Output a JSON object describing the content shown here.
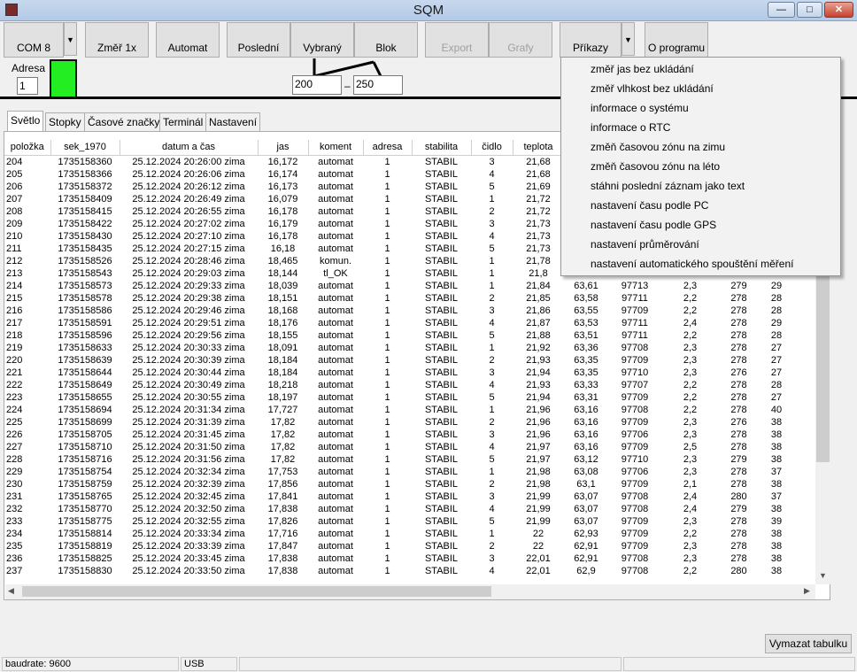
{
  "window": {
    "title": "SQM",
    "minimize": "—",
    "maximize": "□",
    "close": "✕",
    "icon": "sqm-app-icon"
  },
  "toolbar": {
    "com": "COM 8",
    "zmer": "Změř 1x",
    "automat": "Automat",
    "posledni": "Poslední",
    "vybrany": "Vybraný",
    "blok": "Blok",
    "export": "Export",
    "grafy": "Grafy",
    "prikazy": "Příkazy",
    "oprogramu": "O programu",
    "dropdown_arrow": "▼"
  },
  "address": {
    "label": "Adresa",
    "value": "1",
    "indicator_color": "#22ee22"
  },
  "range": {
    "from": "200",
    "dash": "–",
    "to": "250"
  },
  "tabs": [
    "Světlo",
    "Stopky",
    "Časové značky",
    "Terminál",
    "Nastavení"
  ],
  "columns": [
    "položka",
    "sek_1970",
    "datum a čas",
    "jas",
    "koment",
    "adresa",
    "stabilita",
    "čidlo",
    "teplota",
    "",
    "",
    "",
    "",
    ""
  ],
  "rows": [
    [
      "204",
      "1735158360",
      "25.12.2024 20:26:00 zima",
      "16,172",
      "automat",
      "1",
      "STABIL",
      "3",
      "21,68",
      "",
      "",
      "",
      "",
      ""
    ],
    [
      "205",
      "1735158366",
      "25.12.2024 20:26:06 zima",
      "16,174",
      "automat",
      "1",
      "STABIL",
      "4",
      "21,68",
      "",
      "",
      "",
      "",
      ""
    ],
    [
      "206",
      "1735158372",
      "25.12.2024 20:26:12 zima",
      "16,173",
      "automat",
      "1",
      "STABIL",
      "5",
      "21,69",
      "",
      "",
      "",
      "",
      ""
    ],
    [
      "207",
      "1735158409",
      "25.12.2024 20:26:49 zima",
      "16,079",
      "automat",
      "1",
      "STABIL",
      "1",
      "21,72",
      "",
      "",
      "",
      "",
      ""
    ],
    [
      "208",
      "1735158415",
      "25.12.2024 20:26:55 zima",
      "16,178",
      "automat",
      "1",
      "STABIL",
      "2",
      "21,72",
      "",
      "",
      "",
      "",
      ""
    ],
    [
      "209",
      "1735158422",
      "25.12.2024 20:27:02 zima",
      "16,179",
      "automat",
      "1",
      "STABIL",
      "3",
      "21,73",
      "",
      "",
      "",
      "",
      ""
    ],
    [
      "210",
      "1735158430",
      "25.12.2024 20:27:10 zima",
      "16,178",
      "automat",
      "1",
      "STABIL",
      "4",
      "21,73",
      "",
      "",
      "",
      "",
      ""
    ],
    [
      "211",
      "1735158435",
      "25.12.2024 20:27:15 zima",
      "16,18",
      "automat",
      "1",
      "STABIL",
      "5",
      "21,73",
      "",
      "",
      "",
      "",
      ""
    ],
    [
      "212",
      "1735158526",
      "25.12.2024 20:28:46 zima",
      "18,465",
      "komun.",
      "1",
      "STABIL",
      "1",
      "21,78",
      "",
      "",
      "",
      "",
      ""
    ],
    [
      "213",
      "1735158543",
      "25.12.2024 20:29:03 zima",
      "18,144",
      "tl_OK",
      "1",
      "STABIL",
      "1",
      "21,8",
      "",
      "",
      "",
      "",
      ""
    ],
    [
      "214",
      "1735158573",
      "25.12.2024 20:29:33 zima",
      "18,039",
      "automat",
      "1",
      "STABIL",
      "1",
      "21,84",
      "63,61",
      "97713",
      "2,3",
      "279",
      "29"
    ],
    [
      "215",
      "1735158578",
      "25.12.2024 20:29:38 zima",
      "18,151",
      "automat",
      "1",
      "STABIL",
      "2",
      "21,85",
      "63,58",
      "97711",
      "2,2",
      "278",
      "28"
    ],
    [
      "216",
      "1735158586",
      "25.12.2024 20:29:46 zima",
      "18,168",
      "automat",
      "1",
      "STABIL",
      "3",
      "21,86",
      "63,55",
      "97709",
      "2,2",
      "278",
      "28"
    ],
    [
      "217",
      "1735158591",
      "25.12.2024 20:29:51 zima",
      "18,176",
      "automat",
      "1",
      "STABIL",
      "4",
      "21,87",
      "63,53",
      "97711",
      "2,4",
      "278",
      "29"
    ],
    [
      "218",
      "1735158596",
      "25.12.2024 20:29:56 zima",
      "18,155",
      "automat",
      "1",
      "STABIL",
      "5",
      "21,88",
      "63,51",
      "97711",
      "2,2",
      "278",
      "28"
    ],
    [
      "219",
      "1735158633",
      "25.12.2024 20:30:33 zima",
      "18,091",
      "automat",
      "1",
      "STABIL",
      "1",
      "21,92",
      "63,36",
      "97708",
      "2,3",
      "278",
      "27"
    ],
    [
      "220",
      "1735158639",
      "25.12.2024 20:30:39 zima",
      "18,184",
      "automat",
      "1",
      "STABIL",
      "2",
      "21,93",
      "63,35",
      "97709",
      "2,3",
      "278",
      "27"
    ],
    [
      "221",
      "1735158644",
      "25.12.2024 20:30:44 zima",
      "18,184",
      "automat",
      "1",
      "STABIL",
      "3",
      "21,94",
      "63,35",
      "97710",
      "2,3",
      "276",
      "27"
    ],
    [
      "222",
      "1735158649",
      "25.12.2024 20:30:49 zima",
      "18,218",
      "automat",
      "1",
      "STABIL",
      "4",
      "21,93",
      "63,33",
      "97707",
      "2,2",
      "278",
      "28"
    ],
    [
      "223",
      "1735158655",
      "25.12.2024 20:30:55 zima",
      "18,197",
      "automat",
      "1",
      "STABIL",
      "5",
      "21,94",
      "63,31",
      "97709",
      "2,2",
      "278",
      "27"
    ],
    [
      "224",
      "1735158694",
      "25.12.2024 20:31:34 zima",
      "17,727",
      "automat",
      "1",
      "STABIL",
      "1",
      "21,96",
      "63,16",
      "97708",
      "2,2",
      "278",
      "40"
    ],
    [
      "225",
      "1735158699",
      "25.12.2024 20:31:39 zima",
      "17,82",
      "automat",
      "1",
      "STABIL",
      "2",
      "21,96",
      "63,16",
      "97709",
      "2,3",
      "276",
      "38"
    ],
    [
      "226",
      "1735158705",
      "25.12.2024 20:31:45 zima",
      "17,82",
      "automat",
      "1",
      "STABIL",
      "3",
      "21,96",
      "63,16",
      "97706",
      "2,3",
      "278",
      "38"
    ],
    [
      "227",
      "1735158710",
      "25.12.2024 20:31:50 zima",
      "17,82",
      "automat",
      "1",
      "STABIL",
      "4",
      "21,97",
      "63,16",
      "97709",
      "2,5",
      "278",
      "38"
    ],
    [
      "228",
      "1735158716",
      "25.12.2024 20:31:56 zima",
      "17,82",
      "automat",
      "1",
      "STABIL",
      "5",
      "21,97",
      "63,12",
      "97710",
      "2,3",
      "279",
      "38"
    ],
    [
      "229",
      "1735158754",
      "25.12.2024 20:32:34 zima",
      "17,753",
      "automat",
      "1",
      "STABIL",
      "1",
      "21,98",
      "63,08",
      "97706",
      "2,3",
      "278",
      "37"
    ],
    [
      "230",
      "1735158759",
      "25.12.2024 20:32:39 zima",
      "17,856",
      "automat",
      "1",
      "STABIL",
      "2",
      "21,98",
      "63,1",
      "97709",
      "2,1",
      "278",
      "38"
    ],
    [
      "231",
      "1735158765",
      "25.12.2024 20:32:45 zima",
      "17,841",
      "automat",
      "1",
      "STABIL",
      "3",
      "21,99",
      "63,07",
      "97708",
      "2,4",
      "280",
      "37"
    ],
    [
      "232",
      "1735158770",
      "25.12.2024 20:32:50 zima",
      "17,838",
      "automat",
      "1",
      "STABIL",
      "4",
      "21,99",
      "63,07",
      "97708",
      "2,4",
      "279",
      "38"
    ],
    [
      "233",
      "1735158775",
      "25.12.2024 20:32:55 zima",
      "17,826",
      "automat",
      "1",
      "STABIL",
      "5",
      "21,99",
      "63,07",
      "97709",
      "2,3",
      "278",
      "39"
    ],
    [
      "234",
      "1735158814",
      "25.12.2024 20:33:34 zima",
      "17,716",
      "automat",
      "1",
      "STABIL",
      "1",
      "22",
      "62,93",
      "97709",
      "2,2",
      "278",
      "38"
    ],
    [
      "235",
      "1735158819",
      "25.12.2024 20:33:39 zima",
      "17,847",
      "automat",
      "1",
      "STABIL",
      "2",
      "22",
      "62,91",
      "97709",
      "2,3",
      "278",
      "38"
    ],
    [
      "236",
      "1735158825",
      "25.12.2024 20:33:45 zima",
      "17,838",
      "automat",
      "1",
      "STABIL",
      "3",
      "22,01",
      "62,91",
      "97708",
      "2,3",
      "278",
      "38"
    ],
    [
      "237",
      "1735158830",
      "25.12.2024 20:33:50 zima",
      "17,838",
      "automat",
      "1",
      "STABIL",
      "4",
      "22,01",
      "62,9",
      "97708",
      "2,2",
      "280",
      "38"
    ]
  ],
  "menu": [
    "změř jas bez ukládání",
    "změř vlhkost bez ukládání",
    "informace o systému",
    "informace o RTC",
    "změň časovou zónu na zimu",
    "změň časovou zónu na léto",
    "stáhni poslední záznam jako text",
    "nastavení času podle PC",
    "nastavení času podle GPS",
    "nastavení průměrování",
    "nastavení automatického spouštění měření"
  ],
  "buttons": {
    "clear": "Vymazat tabulku"
  },
  "status": {
    "baud": "baudrate: 9600",
    "port": "USB"
  },
  "scroll": {
    "up": "▲",
    "down": "▼",
    "left": "◀",
    "right": "▶"
  }
}
